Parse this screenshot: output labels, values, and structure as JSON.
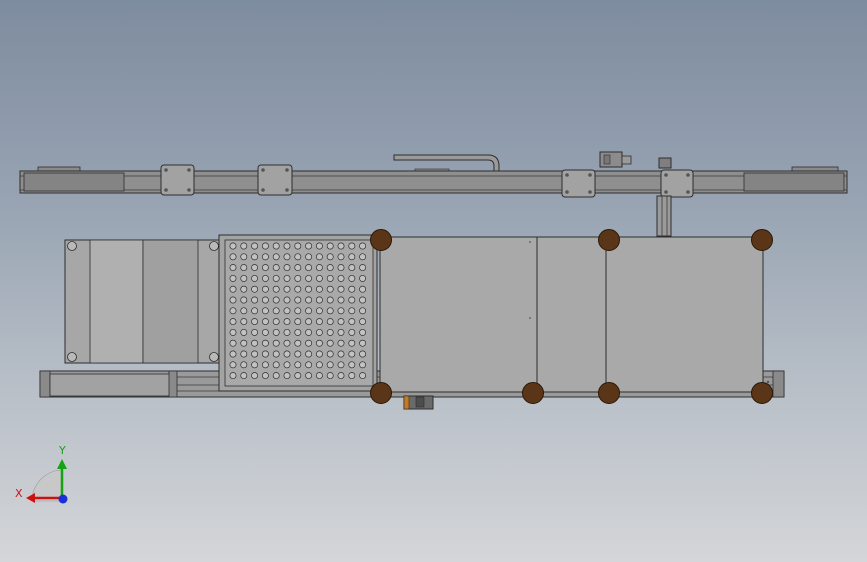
{
  "viewport": {
    "background_top": "#7e8c9f",
    "background_bottom": "#d4d6d9",
    "view": "top"
  },
  "colors": {
    "rail": "#8f8f8f",
    "rail_dark": "#6b6b6b",
    "panel": "#a9a9a9",
    "panel_light": "#b3b3b3",
    "perforated_plate": "#a6a6a6",
    "caster": "#5a3517",
    "outline": "#2d2d2d"
  },
  "triad": {
    "x_label": "X",
    "y_label": "Y",
    "x_color": "#cc1111",
    "y_color": "#13a313",
    "z_color": "#1a2fd8",
    "icon": "coordinate-triad-icon"
  }
}
